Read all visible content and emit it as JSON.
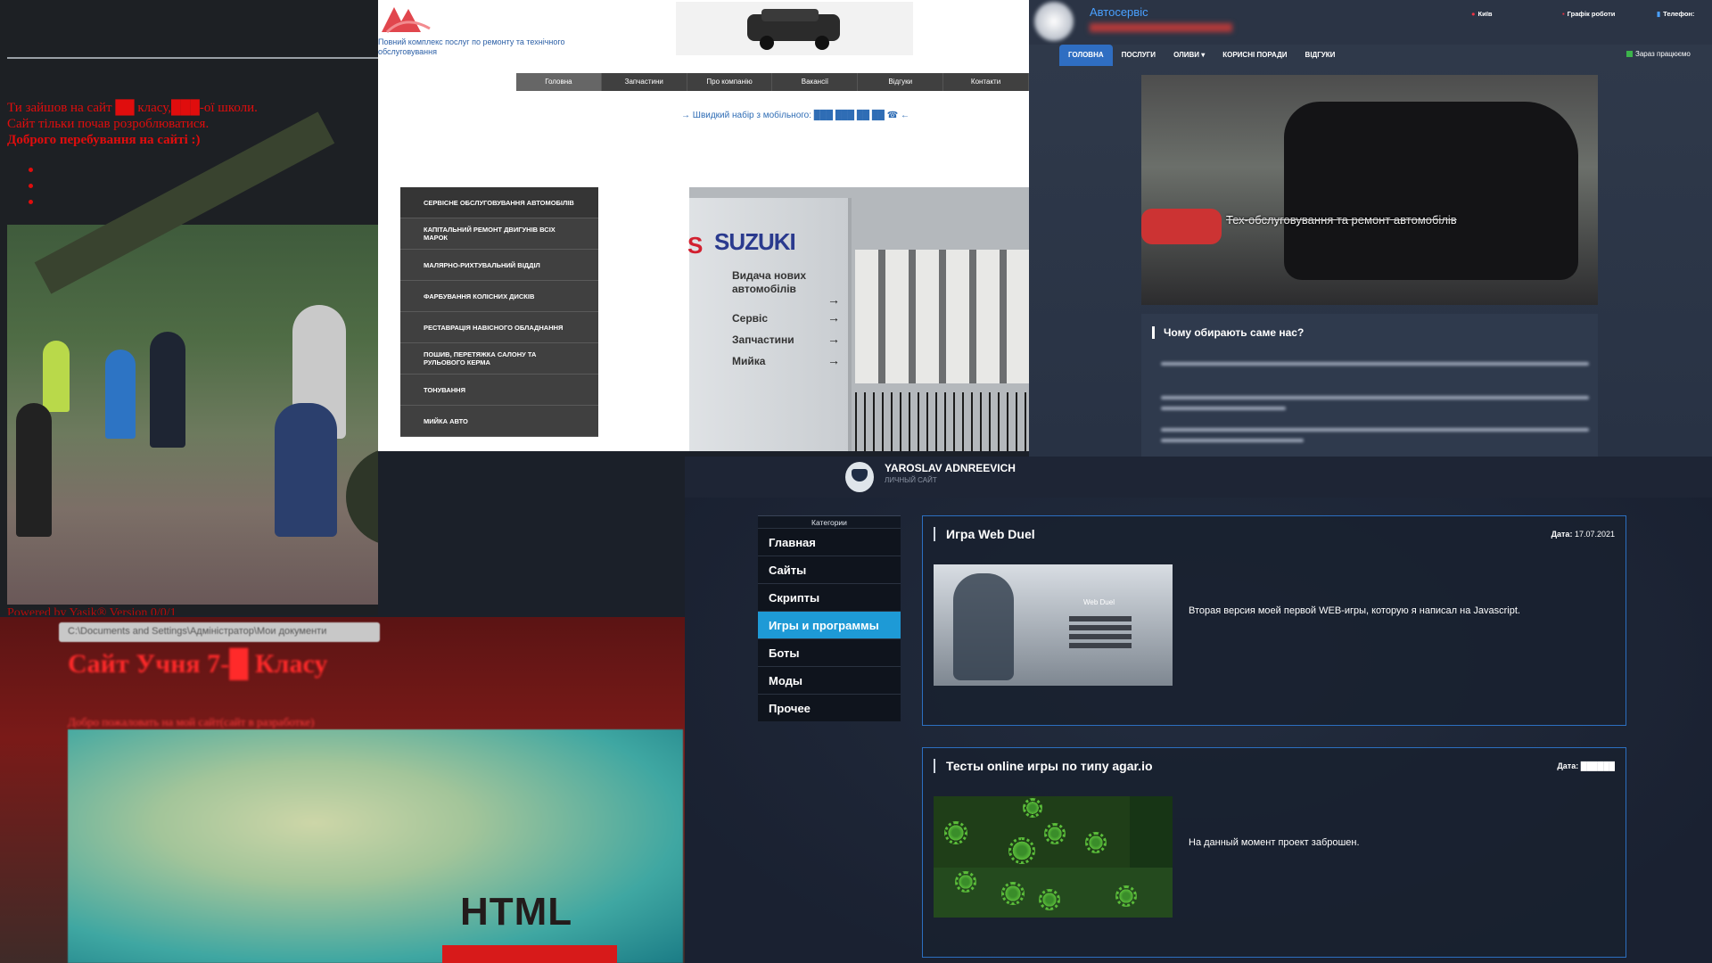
{
  "panel_a": {
    "line1": "Ти зайшов на сайт ██ класу,███-ої школи.",
    "line2": "Сайт тільки почав розроблюватися.",
    "line3": "Доброго перебування на сайті :)",
    "footer": "Powered by Yasik® Version 0/0/1"
  },
  "panel_b": {
    "address": "C:\\Documents and Settings\\Адміністратор\\Мои документи",
    "title": "Сайт Учня 7-█ Класу",
    "subtitle": "Добро пожаловать на мой сайт(сайт в разработке)",
    "screen_text": "HTML"
  },
  "panel_c": {
    "tagline": "Повний комплекс послуг по ремонту та технічного обслуговування",
    "nav": [
      "Головна",
      "Запчастини",
      "Про компанію",
      "Вакансії",
      "Відгуки",
      "Контакти"
    ],
    "phone": "→ Швидкий набір з мобільного: ███ ███ ██ ██ ☎ ←",
    "menu": [
      "СЕРВІСНЕ ОБСЛУГОВУВАННЯ АВТОМОБІЛІВ",
      "КАПІТАЛЬНИЙ РЕМОНТ ДВИГУНІВ ВСІХ МАРОК",
      "МАЛЯРНО-РИХТУВАЛЬНИЙ ВІДДІЛ",
      "ФАРБУВАННЯ КОЛІСНИХ ДИСКІВ",
      "РЕСТАВРАЦІЯ НАВІСНОГО ОБЛАДНАННЯ",
      "ПОШИВ, ПЕРЕТЯЖКА САЛОНУ ТА РУЛЬОВОГО КЕРМА",
      "ТОНУВАННЯ",
      "МИЙКА АВТО"
    ],
    "sign": {
      "brand": "SUZUKI",
      "items": [
        "Видача нових автомобілів",
        "Сервіс",
        "Запчастини",
        "Мийка"
      ]
    }
  },
  "panel_d": {
    "name": "Автосервіс",
    "city": "Київ",
    "schedule": "Графік роботи",
    "phone_label": "Телефон:",
    "nav": [
      "ГОЛОВНА",
      "ПОСЛУГИ",
      "ОЛИВИ ▾",
      "КОРИСНІ ПОРАДИ",
      "ВІДГУКИ"
    ],
    "status": "Зараз працюємо",
    "hero_caption": "Тех-обслуговування та ремонт автомобілів",
    "why_title": "Чому обирають саме нас?"
  },
  "panel_e": {
    "site_name": "YAROSLAV ADNREEVICH",
    "site_sub": "ЛИЧНЫЙ САЙТ",
    "categories_title": "Категории",
    "categories": [
      "Главная",
      "Сайты",
      "Скрипты",
      "Игры и программы",
      "Боты",
      "Моды",
      "Прочее"
    ],
    "active_category": "Игры и программы",
    "posts": [
      {
        "title": "Игра Web Duel",
        "date_label": "Дата:",
        "date": "17.07.2021",
        "description": "Вторая версия моей первой WEB-игры, которую я написал на Javascript.",
        "thumb_title": "Web Duel"
      },
      {
        "title": "Тесты online игры по типу agar.io",
        "date_label": "Дата:",
        "date": "██████",
        "description": "На данный момент проект заброшен."
      }
    ]
  }
}
